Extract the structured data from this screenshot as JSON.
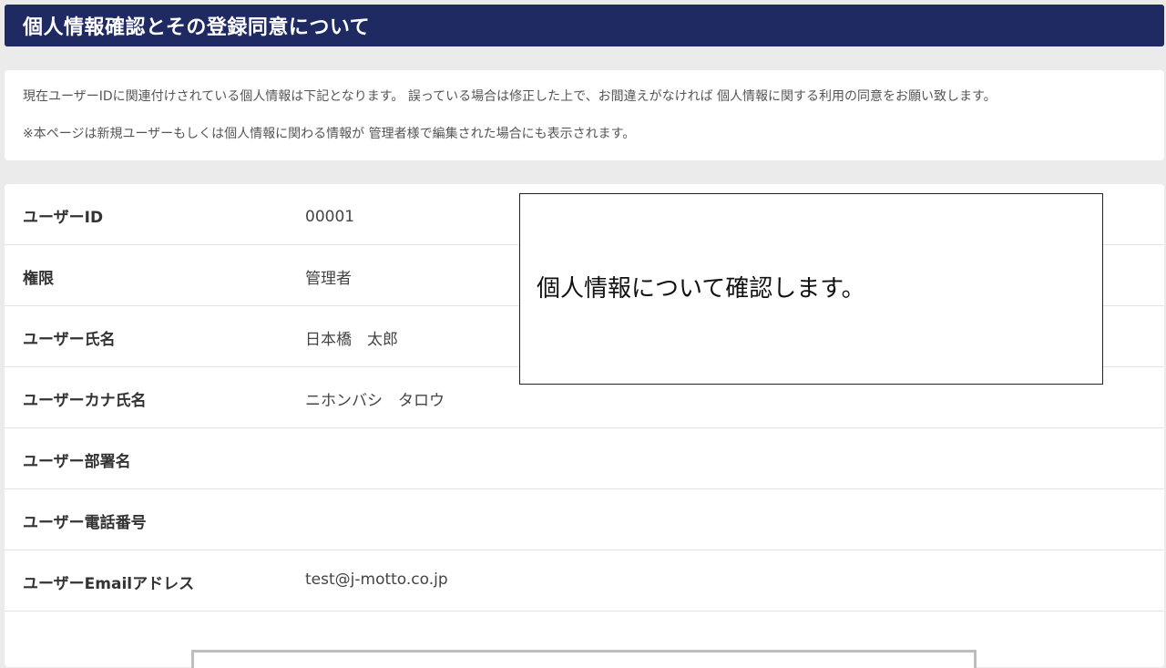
{
  "header": {
    "title": "個人情報確認とその登録同意について"
  },
  "notice": {
    "line1": "現在ユーザーIDに関連付けされている個人情報は下記となります。 誤っている場合は修正した上で、お間違えがなければ 個人情報に関する利用の同意をお願い致します。",
    "line2": "※本ページは新規ユーザーもしくは個人情報に関わる情報が 管理者様で編集された場合にも表示されます。"
  },
  "fields": [
    {
      "label": "ユーザーID",
      "value": "00001"
    },
    {
      "label": "権限",
      "value": "管理者"
    },
    {
      "label": "ユーザー氏名",
      "value": "日本橋　太郎"
    },
    {
      "label": "ユーザーカナ氏名",
      "value": "ニホンバシ　タロウ"
    },
    {
      "label": "ユーザー部署名",
      "value": ""
    },
    {
      "label": "ユーザー電話番号",
      "value": ""
    },
    {
      "label": "ユーザーEmailアドレス",
      "value": "test@j-motto.co.jp"
    }
  ],
  "callout": {
    "text": "個人情報について確認します。"
  },
  "colors": {
    "header_bg": "#1f2a63",
    "page_bg": "#ebebeb",
    "panel_bg": "#ffffff"
  }
}
